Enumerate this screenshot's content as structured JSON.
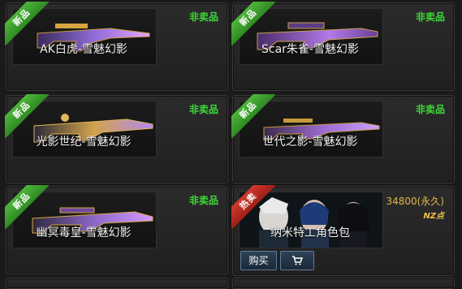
{
  "items": [
    {
      "badge": "新品",
      "name": "AK白虎-雪魅幻影",
      "status": "非卖品"
    },
    {
      "badge": "新品",
      "name": "Scar朱雀-雪魅幻影",
      "status": "非卖品"
    },
    {
      "badge": "新品",
      "name": "光影世纪-雪魅幻影",
      "status": "非卖品"
    },
    {
      "badge": "新品",
      "name": "世代之影-雪魅幻影",
      "status": "非卖品"
    },
    {
      "badge": "新品",
      "name": "幽冥毒皇-雪魅幻影",
      "status": "非卖品"
    },
    {
      "badge": "热卖",
      "name": "纳米特工角色包",
      "price": "34800(永久)",
      "currency": "NZ点",
      "buy_label": "购买"
    }
  ],
  "colors": {
    "new_badge": "#3a9e2c",
    "hot_badge": "#c42a20",
    "status": "#3fd93a",
    "price": "#e3b44a"
  },
  "icons": {
    "cart": "cart-icon"
  }
}
